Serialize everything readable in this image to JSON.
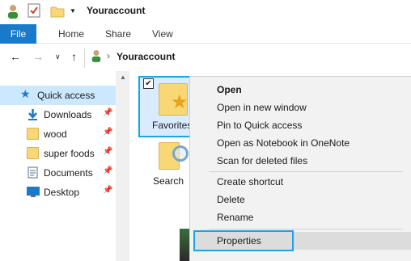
{
  "window": {
    "title": "Youraccount"
  },
  "quick_access_toolbar": [
    {
      "icon": "user-icon"
    },
    {
      "icon": "properties-check-icon"
    },
    {
      "icon": "new-folder-icon"
    },
    {
      "icon": "customize-dropdown-icon"
    }
  ],
  "ribbon": {
    "tabs": [
      {
        "label": "File"
      },
      {
        "label": "Home"
      },
      {
        "label": "Share"
      },
      {
        "label": "View"
      }
    ]
  },
  "address_bar": {
    "location_icon": "user-icon",
    "path": "Youraccount"
  },
  "nav_pane": {
    "items": [
      {
        "label": "Quick access",
        "icon": "star-icon",
        "selected": true
      },
      {
        "label": "Downloads",
        "icon": "download-arrow-icon",
        "pinned": true
      },
      {
        "label": "wood",
        "icon": "folder-icon",
        "pinned": true
      },
      {
        "label": "super foods",
        "icon": "folder-icon",
        "pinned": true
      },
      {
        "label": "Documents",
        "icon": "documents-icon",
        "pinned": true
      },
      {
        "label": "Desktop",
        "icon": "desktop-icon",
        "pinned": true
      }
    ]
  },
  "content": {
    "items": [
      {
        "label": "Favorites",
        "icon": "favorites-folder-icon",
        "selected": true,
        "checked": true
      },
      {
        "label": "Search",
        "icon": "search-folder-icon"
      }
    ]
  },
  "context_menu": {
    "groups": [
      [
        {
          "label": "Open",
          "default": true
        },
        {
          "label": "Open in new window"
        },
        {
          "label": "Pin to Quick access"
        },
        {
          "label": "Open as Notebook in OneNote"
        },
        {
          "label": "Scan for deleted files"
        }
      ],
      [
        {
          "label": "Create shortcut"
        },
        {
          "label": "Delete"
        },
        {
          "label": "Rename"
        }
      ],
      [
        {
          "label": "Properties",
          "highlighted": true
        }
      ]
    ]
  },
  "colors": {
    "accent": "#1979ca",
    "highlight_outline": "#1aa3e8",
    "selection": "#cce8ff",
    "folder": "#f8d775"
  }
}
